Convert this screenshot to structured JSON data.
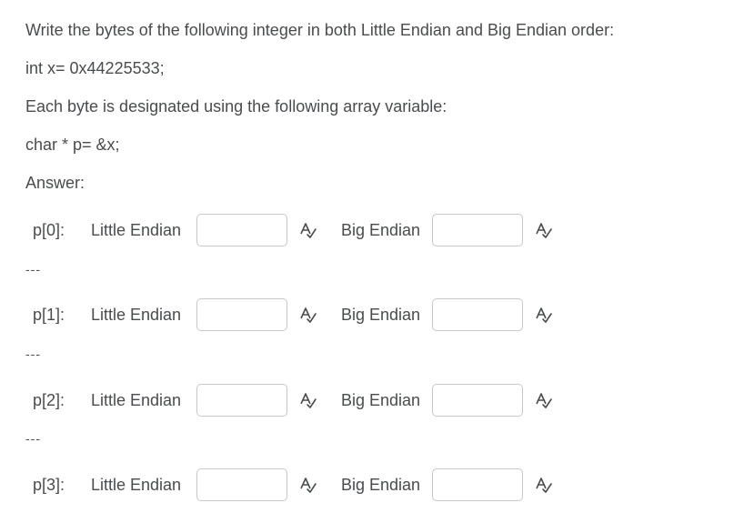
{
  "question": {
    "prompt": "Write the bytes of the following integer in both Little Endian and Big Endian order:",
    "declaration": "int x= 0x44225533;",
    "designation": "Each byte is designated using the following array variable:",
    "pointer": "char * p= &x;",
    "answer_label": "Answer:"
  },
  "rows": [
    {
      "label": "p[0]:",
      "little_label": "Little Endian",
      "little_value": "",
      "big_label": "Big Endian",
      "big_value": ""
    },
    {
      "label": "p[1]:",
      "little_label": "Little Endian",
      "little_value": "",
      "big_label": "Big Endian",
      "big_value": ""
    },
    {
      "label": "p[2]:",
      "little_label": "Little Endian",
      "little_value": "",
      "big_label": "Big Endian",
      "big_value": ""
    },
    {
      "label": "p[3]:",
      "little_label": "Little Endian",
      "little_value": "",
      "big_label": "Big Endian",
      "big_value": ""
    }
  ],
  "separator": "---",
  "icons": {
    "spellcheck": "spellcheck-icon"
  },
  "colors": {
    "text": "#494c4e",
    "input_border": "#c5c7c8"
  }
}
